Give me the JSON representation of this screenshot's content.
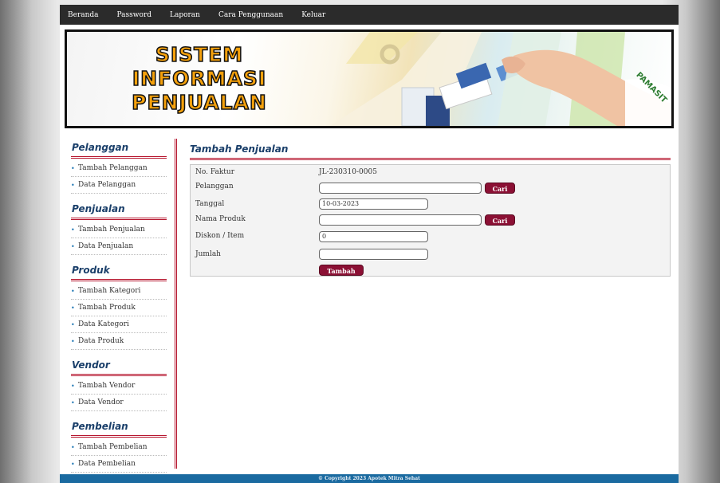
{
  "nav": {
    "items": [
      "Beranda",
      "Password",
      "Laporan",
      "Cara Penggunaan",
      "Keluar"
    ]
  },
  "banner": {
    "title_lines": [
      "SISTEM",
      "INFORMASI",
      "PENJUALAN"
    ],
    "stamp": "PAMASIT"
  },
  "sidebar": {
    "sections": [
      {
        "title": "Pelanggan",
        "items": [
          "Tambah Pelanggan",
          "Data Pelanggan"
        ]
      },
      {
        "title": "Penjualan",
        "items": [
          "Tambah Penjualan",
          "Data Penjualan"
        ]
      },
      {
        "title": "Produk",
        "items": [
          "Tambah Kategori",
          "Tambah Produk",
          "Data Kategori",
          "Data Produk"
        ]
      },
      {
        "title": "Vendor",
        "items": [
          "Tambah Vendor",
          "Data Vendor"
        ]
      },
      {
        "title": "Pembelian",
        "items": [
          "Tambah Pembelian",
          "Data Pembelian"
        ]
      }
    ]
  },
  "main": {
    "title": "Tambah Penjualan",
    "form": {
      "no_faktur_label": "No. Faktur",
      "no_faktur_value": "JL-230310-0005",
      "pelanggan_label": "Pelanggan",
      "pelanggan_value": "",
      "cari_label": "Cari",
      "tanggal_label": "Tanggal",
      "tanggal_value": "10-03-2023",
      "nama_produk_label": "Nama Produk",
      "nama_produk_value": "",
      "diskon_label": "Diskon / Item",
      "diskon_value": "0",
      "jumlah_label": "Jumlah",
      "jumlah_value": "",
      "submit_label": "Tambah"
    }
  },
  "footer": {
    "text": "© Copyright 2023 Apotek Mitra Sehat"
  },
  "colors": {
    "nav_bg": "#2b2b2b",
    "accent": "#b5132c",
    "heading": "#1a3f6a",
    "button": "#8b1034",
    "footer_bg": "#1a6aa0"
  }
}
